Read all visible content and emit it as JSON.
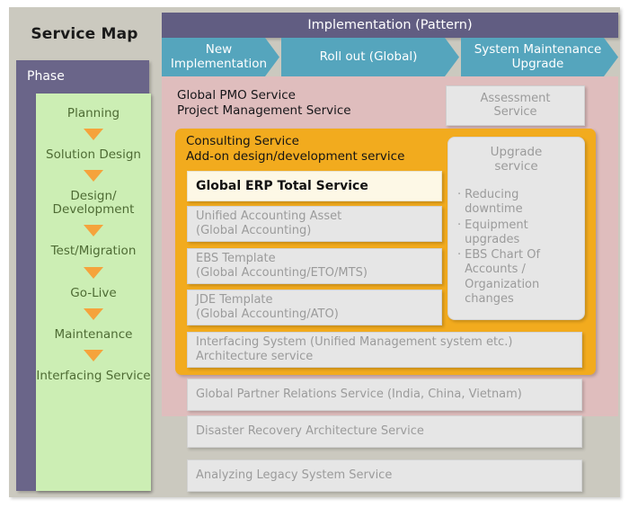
{
  "title": "Service Map",
  "phase": {
    "header": "Phase",
    "steps": [
      "Planning",
      "Solution Design",
      "Design/\nDevelopment",
      "Test/Migration",
      "Go-Live",
      "Maintenance",
      "Interfacing\nService"
    ]
  },
  "implementation": {
    "header": "Implementation (Pattern)",
    "tabs": [
      "New\nImplementation",
      "Roll out   (Global)",
      "System Maintenance\nUpgrade"
    ]
  },
  "pmo": {
    "title": "Global PMO Service\nProject Management Service"
  },
  "assessment": {
    "label": "Assessment\nService"
  },
  "consulting": {
    "title": "Consulting Service\nAdd-on design/development service",
    "services": [
      "Global ERP Total Service",
      "Unified Accounting Asset\n(Global Accounting)",
      "EBS Template\n(Global Accounting/ETO/MTS)",
      "JDE Template\n(Global Accounting/ATO)"
    ]
  },
  "upgrade": {
    "title": "Upgrade\nservice",
    "bullet": "·",
    "items": [
      "Reducing downtime",
      "Equipment upgrades",
      "EBS Chart Of\nAccounts /\nOrganization\nchanges"
    ]
  },
  "wide_services": [
    "Interfacing System (Unified Management system etc.)\nArchitecture service",
    "Global Partner Relations Service (India, China, Vietnam)",
    "Disaster Recovery Architecture Service",
    "Analyzing Legacy System Service"
  ],
  "colors": {
    "board": "#cbc9bf",
    "phase_panel": "#6a6589",
    "phase_flow": "#cceeb4",
    "arrow": "#f5a33c",
    "header_bar": "#615d82",
    "tab": "#55a5bd",
    "pink": "#dfbdbd",
    "orange": "#f2ab1e",
    "card": "#e6e6e6",
    "highlight": "#fdf8e6"
  }
}
